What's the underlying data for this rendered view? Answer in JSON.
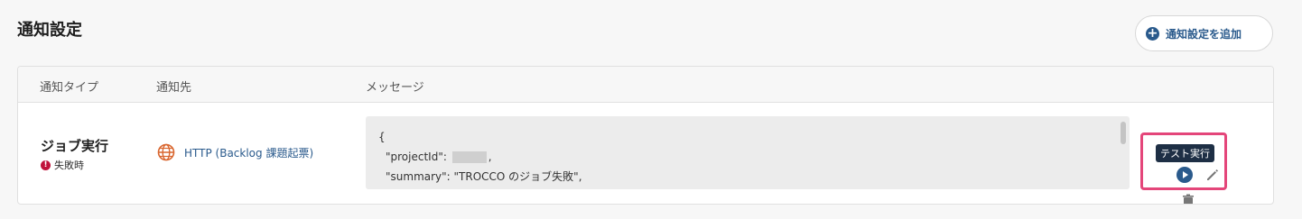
{
  "header": {
    "title": "通知設定",
    "add_button_label": "通知設定を追加"
  },
  "table": {
    "columns": [
      "通知タイプ",
      "通知先",
      "メッセージ"
    ],
    "rows": [
      {
        "type": "ジョブ実行",
        "condition": "失敗時",
        "destination": "HTTP (Backlog 課題起票)",
        "message": {
          "open_brace": "{",
          "project_id_key": "\"projectId\":",
          "project_id_suffix": ",",
          "summary_line": "\"summary\": \"TROCCO のジョブ失敗\","
        }
      }
    ]
  },
  "actions": {
    "tooltip": "テスト実行",
    "icons": [
      "play-icon",
      "pencil-icon",
      "trash-icon"
    ]
  },
  "colors": {
    "accent": "#2a5a8c",
    "error": "#c0123a",
    "highlight": "#e4467a",
    "tooltip_bg": "#1e2f45"
  }
}
